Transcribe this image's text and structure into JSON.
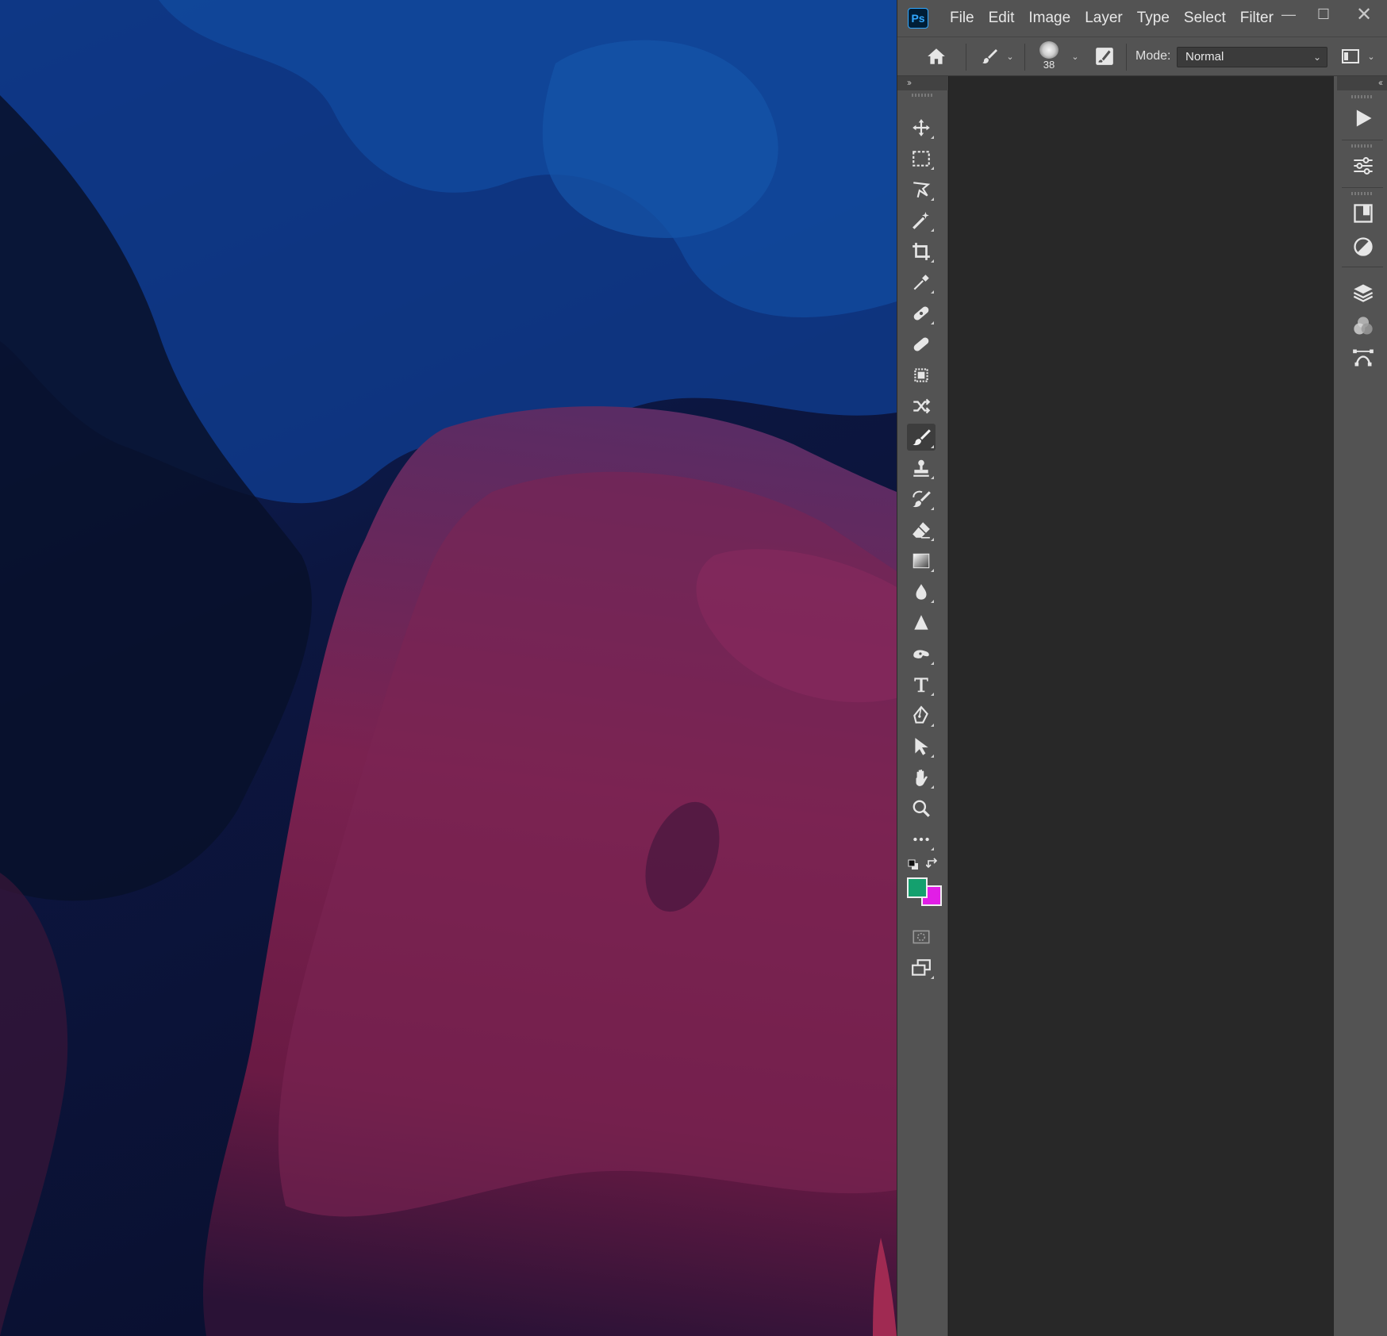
{
  "app": {
    "name": "Photoshop",
    "logo_text": "Ps"
  },
  "menu": [
    "File",
    "Edit",
    "Image",
    "Layer",
    "Type",
    "Select",
    "Filter"
  ],
  "window_controls": {
    "minimize": "—",
    "maximize": "☐",
    "close": "✕"
  },
  "options_bar": {
    "brush_size": "38",
    "mode_label": "Mode:",
    "mode_value": "Normal"
  },
  "tools": [
    "move",
    "rectangular-marquee",
    "lasso",
    "magic-wand",
    "crop",
    "eyedropper",
    "spot-healing-brush",
    "healing-brush",
    "content-aware-move",
    "red-eye",
    "brush",
    "clone-stamp",
    "history-brush",
    "eraser",
    "gradient",
    "blur",
    "sharpen",
    "smudge",
    "type",
    "pen",
    "path-selection",
    "hand",
    "zoom",
    "edit-toolbar",
    "quick-mask",
    "screen-mode"
  ],
  "active_tool": "brush",
  "colors": {
    "foreground": "#14a06e",
    "background": "#e11ee6",
    "ui_bg": "#535353",
    "canvas_bg": "#282828"
  },
  "panels": [
    "actions",
    "adjustments",
    "libraries",
    "properties",
    "layers",
    "channels",
    "paths"
  ]
}
